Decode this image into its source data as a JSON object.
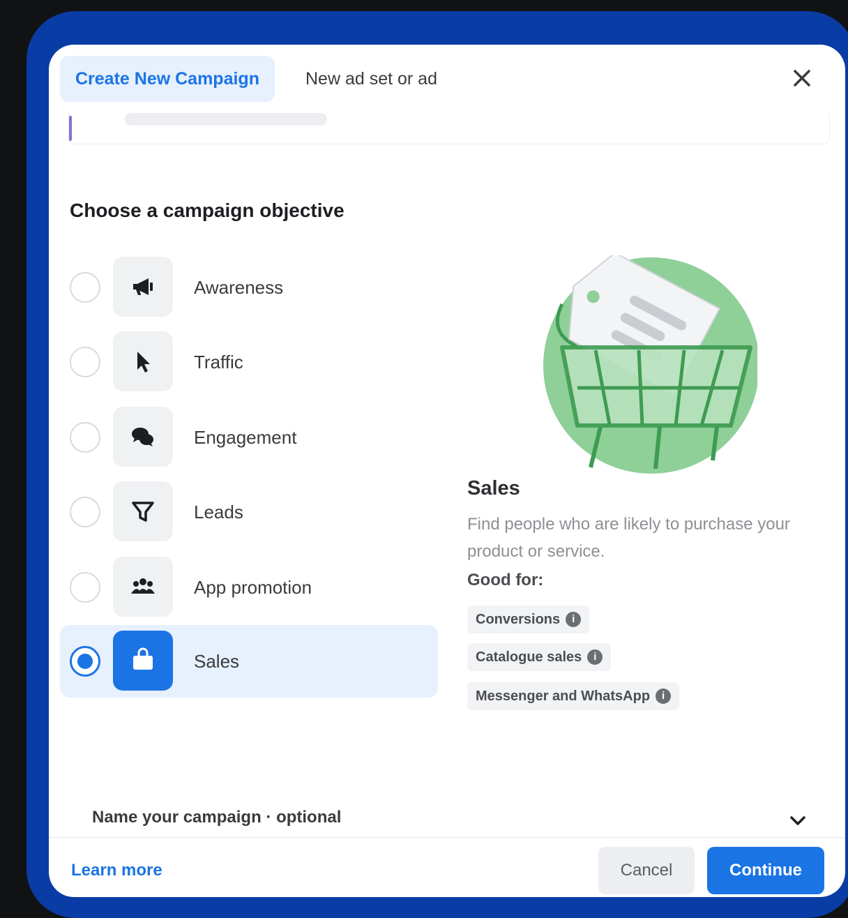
{
  "tabs": {
    "create_new": "Create New Campaign",
    "new_ad_set": "New ad set or ad"
  },
  "objective_section": {
    "title": "Choose a campaign objective",
    "items": [
      {
        "label": "Awareness",
        "icon": "megaphone-icon",
        "selected": false
      },
      {
        "label": "Traffic",
        "icon": "cursor-icon",
        "selected": false
      },
      {
        "label": "Engagement",
        "icon": "chat-bubbles-icon",
        "selected": false
      },
      {
        "label": "Leads",
        "icon": "funnel-icon",
        "selected": false
      },
      {
        "label": "App promotion",
        "icon": "people-icon",
        "selected": false
      },
      {
        "label": "Sales",
        "icon": "shopping-bag-icon",
        "selected": true
      }
    ]
  },
  "detail": {
    "title": "Sales",
    "description": "Find people who are likely to purchase your product or service.",
    "good_for_label": "Good for:",
    "tags": [
      "Conversions",
      "Catalogue sales",
      "Messenger and WhatsApp"
    ]
  },
  "footer": {
    "name_campaign_label": "Name your campaign · optional",
    "learn_more": "Learn more",
    "cancel": "Cancel",
    "continue": "Continue"
  },
  "colors": {
    "accent": "#1b74e4",
    "frame": "#0a3ca6",
    "illustration_green": "#7cc48a"
  }
}
